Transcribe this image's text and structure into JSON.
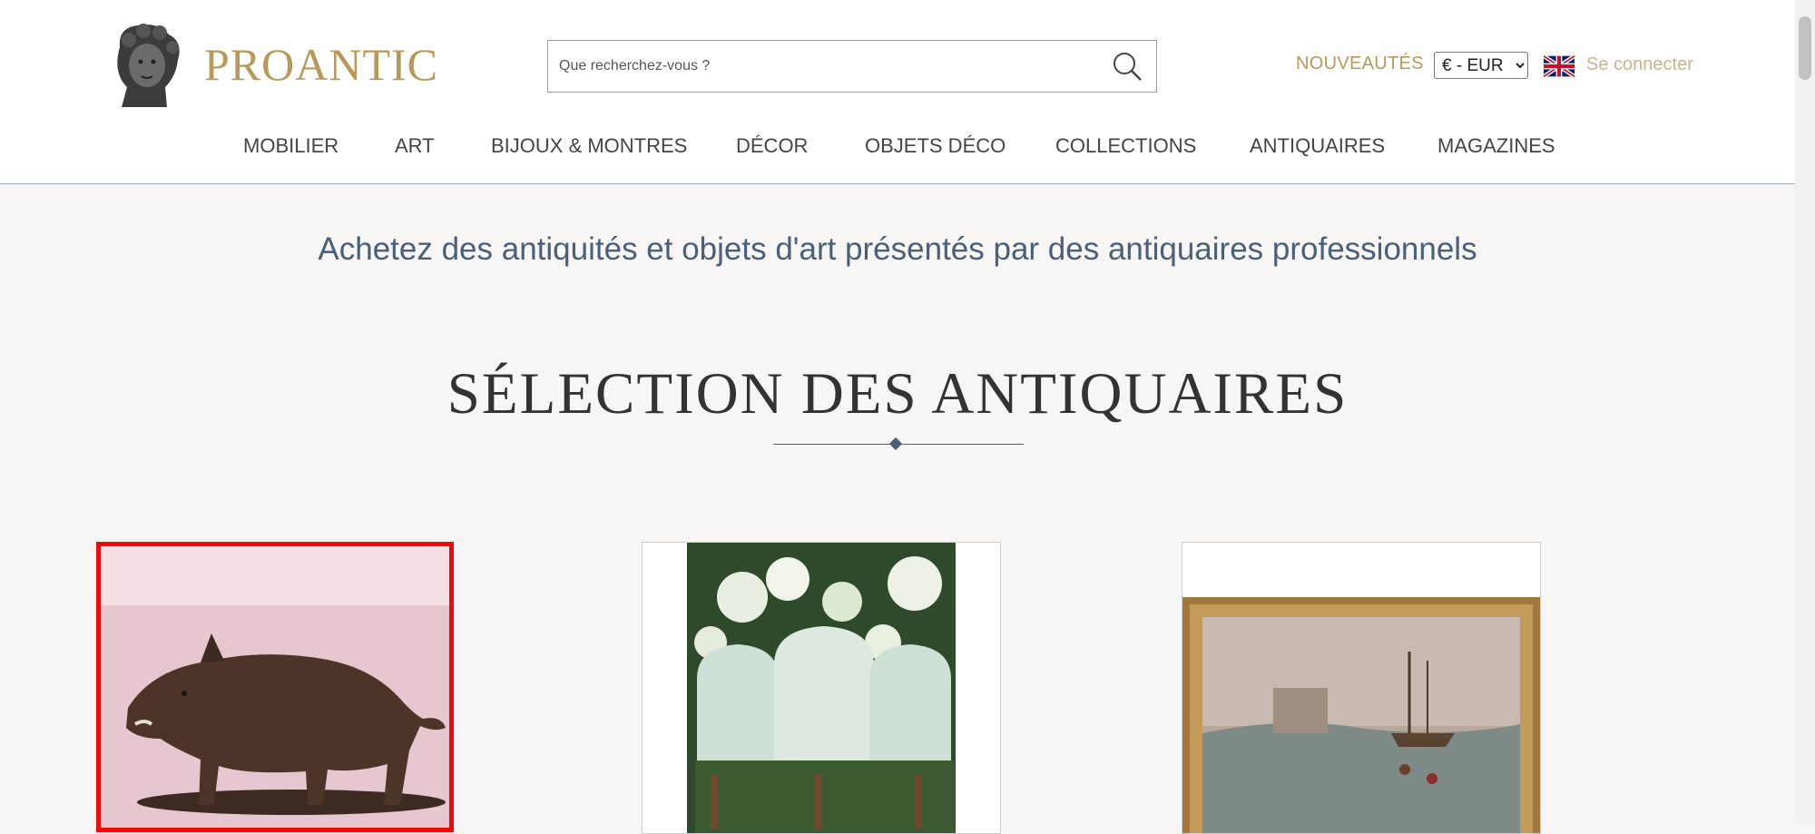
{
  "header": {
    "brand": "PROANTIC",
    "search": {
      "placeholder": "Que recherchez-vous ?",
      "value": ""
    },
    "nouveautes": "NOUVEAUTÉS",
    "currency": {
      "selected": "€ - EUR",
      "options": [
        "€ - EUR"
      ]
    },
    "login": "Se connecter",
    "nav": [
      "MOBILIER",
      "ART",
      "BIJOUX & MONTRES",
      "DÉCOR",
      "OBJETS DÉCO",
      "COLLECTIONS",
      "ANTIQUAIRES",
      "MAGAZINES"
    ]
  },
  "main": {
    "tagline": "Achetez des antiquités et objets d'art présentés par des antiquaires professionnels",
    "section_title": "SÉLECTION DES ANTIQUAIRES",
    "cards": [
      {
        "subject": "bronze boar sculpture",
        "selected": true
      },
      {
        "subject": "upholstered armchairs in garden",
        "selected": false
      },
      {
        "subject": "framed harbour seascape painting",
        "selected": false
      }
    ]
  },
  "colors": {
    "brand_gold": "#b7995a",
    "tagline_blue": "#4a5f78",
    "selection_red": "#ee0a0a"
  },
  "icons": [
    "logo-bust-icon",
    "search-icon",
    "uk-flag-icon",
    "chevron-down-icon"
  ]
}
